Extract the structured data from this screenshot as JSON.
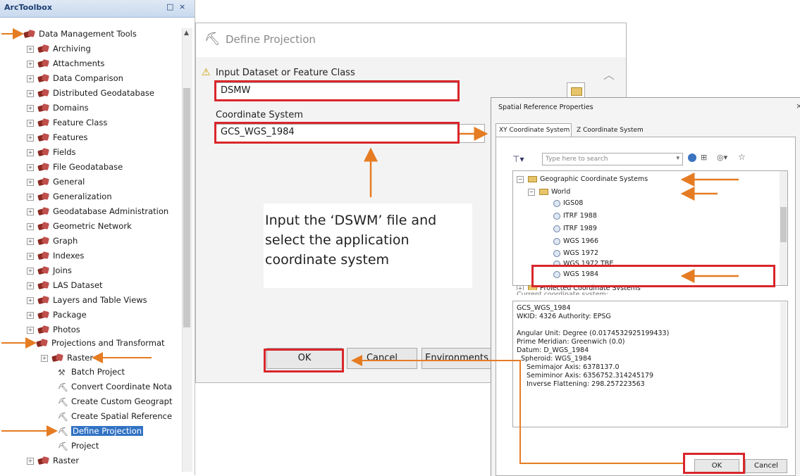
{
  "toolbox": {
    "title": "ArcToolbox",
    "controls": [
      "□",
      "×"
    ],
    "root": "Data Management Tools",
    "items": [
      "Archiving",
      "Attachments",
      "Data Comparison",
      "Distributed Geodatabase",
      "Domains",
      "Feature Class",
      "Features",
      "Fields",
      "File Geodatabase",
      "General",
      "Generalization",
      "Geodatabase Administration",
      "Geometric Network",
      "Graph",
      "Indexes",
      "Joins",
      "LAS Dataset",
      "Layers and Table Views",
      "Package",
      "Photos",
      "Projections and Transformat"
    ],
    "sub_raster": "Raster",
    "tools": [
      "Batch Project",
      "Convert Coordinate Nota",
      "Create Custom Geograpt",
      "Create Spatial Reference",
      "Define Projection",
      "Project"
    ],
    "after": "Raster"
  },
  "define_projection": {
    "title": "Define Projection",
    "input_label": "Input Dataset or Feature Class",
    "input_value": "DSMW",
    "cs_label": "Coordinate System",
    "cs_value": "GCS_WGS_1984",
    "ok": "OK",
    "cancel": "Cancel",
    "environments": "Environments",
    "annotation": "Input the ‘DSWM’ file and select the application coordinate system"
  },
  "spatial_ref": {
    "title": "Spatial Reference Properties",
    "tabs": [
      "XY Coordinate System",
      "Z Coordinate System"
    ],
    "search_placeholder": "Type here to search",
    "tree": {
      "gcs": "Geographic Coordinate Systems",
      "world": "World",
      "items": [
        "IGS08",
        "ITRF 1988",
        "ITRF 1989",
        "WGS 1966",
        "WGS 1972",
        "WGS 1972 TBE",
        "WGS 1984"
      ],
      "projected": "Projected Coordinate Systems"
    },
    "current_label": "Current coordinate system:",
    "details": [
      "GCS_WGS_1984",
      "WKID: 4326 Authority: EPSG",
      "",
      "Angular Unit: Degree (0.0174532925199433)",
      "Prime Meridian: Greenwich (0.0)",
      "Datum: D_WGS_1984",
      "  Spheroid: WGS_1984",
      "    Semimajor Axis: 6378137.0",
      "    Semiminor Axis: 6356752.314245179",
      "    Inverse Flattening: 298.257223563"
    ],
    "ok": "OK",
    "cancel": "Cancel"
  },
  "colors": {
    "highlight_red": "#d9262b",
    "arrow_orange": "#e57c23",
    "selection_blue": "#3172c4"
  }
}
